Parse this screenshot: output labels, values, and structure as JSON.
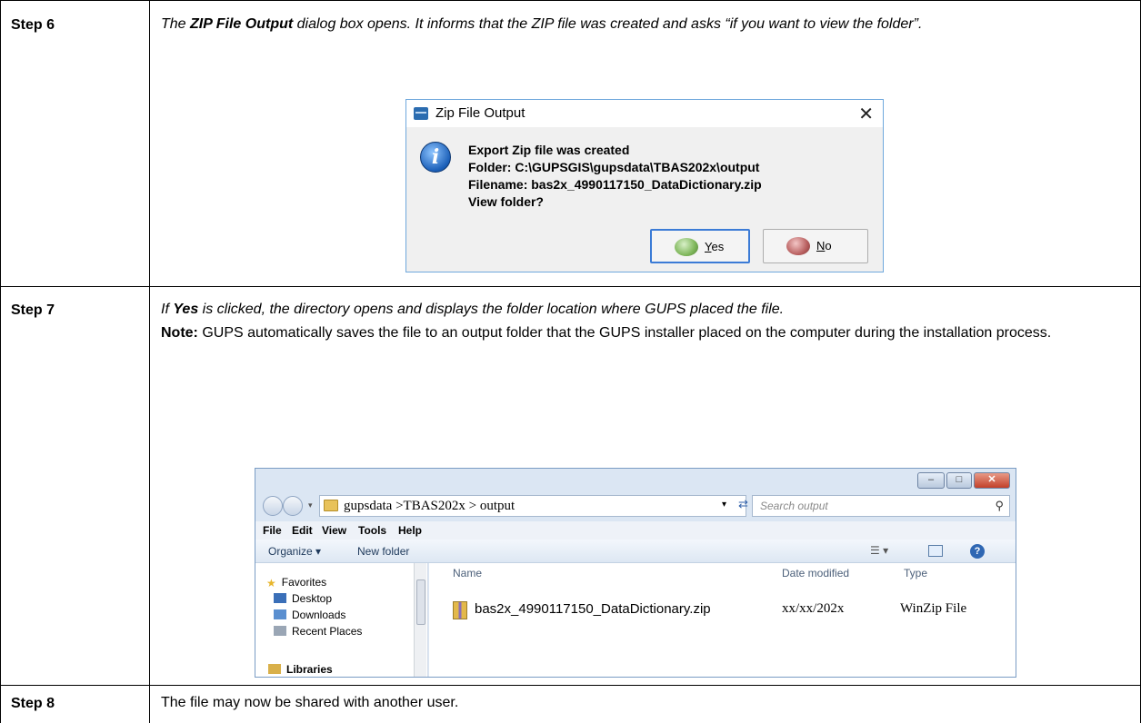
{
  "steps": [
    {
      "label": "Step 6",
      "text_parts": [
        "The ",
        "ZIP File Output",
        " dialog box opens. It informs that the ZIP file was created and asks “if you want to view the folder”."
      ]
    },
    {
      "label": "Step 7",
      "text_parts": [
        "If ",
        "Yes",
        " is clicked, the directory opens and displays the folder location where GUPS placed the file."
      ],
      "note_label": "Note:",
      "note_text": " GUPS automatically saves the file to an output folder that the GUPS installer placed on the computer during the installation process."
    },
    {
      "label": "Step 8",
      "text": "The file may now be shared with another user."
    }
  ],
  "dialog": {
    "title": "Zip File Output",
    "close_glyph": "✕",
    "icon": "info-icon",
    "messages": [
      "Export Zip file was created",
      "Folder:  C:\\GUPSGIS\\gupsdata\\TBAS202x\\output",
      "Filename:  bas2x_4990117150_DataDictionary.zip",
      "View folder?"
    ],
    "yes_label": "Yes",
    "no_label": "No"
  },
  "explorer": {
    "address": "gupsdata >TBAS202x > output",
    "search_placeholder": "Search output",
    "menu": [
      "File",
      "Edit",
      "View",
      "Tools",
      "Help"
    ],
    "toolbar": {
      "organize": "Organize ▾",
      "new_folder": "New folder"
    },
    "nav_items": [
      {
        "label": "Favorites",
        "icon": "star-icon",
        "color": "#e8b62c"
      },
      {
        "label": "Desktop",
        "icon": "desktop-icon",
        "color": "#3a6fb8"
      },
      {
        "label": "Downloads",
        "icon": "downloads-icon",
        "color": "#5a8fd0"
      },
      {
        "label": "Recent Places",
        "icon": "recent-places-icon",
        "color": "#9aa6b5"
      },
      {
        "label": "Libraries",
        "icon": "libraries-icon",
        "color": "#d9b04a"
      }
    ],
    "columns": {
      "name": "Name",
      "date": "Date modified",
      "type": "Type"
    },
    "file": {
      "name": "bas2x_4990117150_DataDictionary.zip",
      "date": "xx/xx/202x",
      "type": "WinZip File"
    }
  }
}
